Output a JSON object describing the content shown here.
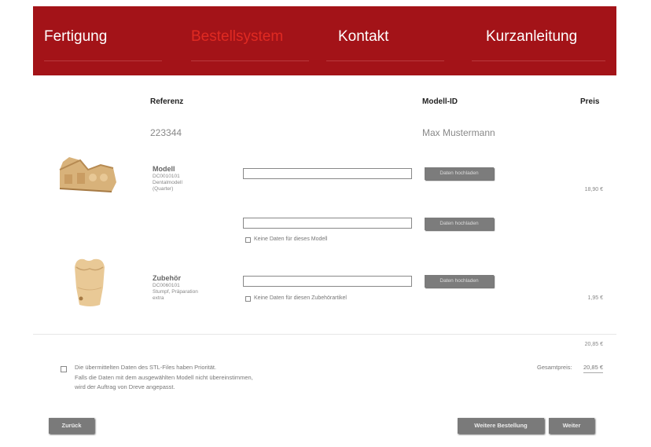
{
  "nav": {
    "items": [
      {
        "label": "Fertigung"
      },
      {
        "label": "Bestellsystem"
      },
      {
        "label": "Kontakt"
      },
      {
        "label": "Kurzanleitung"
      }
    ]
  },
  "headers": {
    "referenz": "Referenz",
    "modell_id": "Modell-ID",
    "preis": "Preis"
  },
  "order": {
    "referenz": "223344",
    "modell_id": "Max Mustermann"
  },
  "products": [
    {
      "name": "Modell",
      "code": "DC0010101",
      "desc1": "Dentalmodell",
      "desc2": "(Quarter)",
      "price": "18,90 €"
    },
    {
      "name": "Zubehör",
      "code": "DC0060101",
      "desc1": "Stumpf, Präparation",
      "desc2": "extra",
      "price": "1,95 €"
    }
  ],
  "upload_label": "Daten hochladen",
  "no_data_model": "Keine Daten für dieses Modell",
  "no_data_accessory": "Keine Daten für diesen Zubehörartikel",
  "subtotal": "20,85 €",
  "total": {
    "label": "Gesamtpreis:",
    "value": "20,85 €"
  },
  "note": {
    "line1": "Die übermittelten Daten des STL-Files haben Priorität.",
    "line2": "Falls die Daten mit dem ausgewählten Modell nicht übereinstimmen,",
    "line3": "wird der Auftrag von Dreve angepasst."
  },
  "buttons": {
    "back": "Zurück",
    "more": "Weitere Bestellung",
    "next": "Weiter"
  },
  "colors": {
    "nav_bg": "#a31318",
    "active_nav": "#e02a22",
    "button": "#7a7a7a"
  }
}
